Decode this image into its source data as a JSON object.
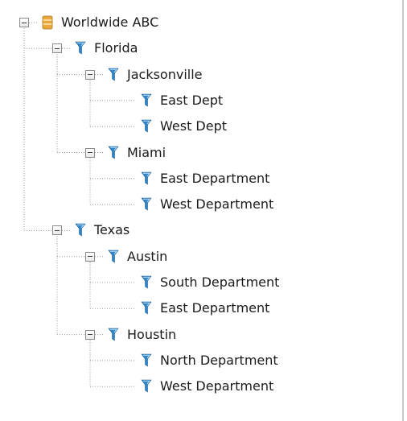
{
  "tree": {
    "nodes": [
      {
        "id": "root",
        "label": "Worldwide ABC",
        "icon": "database-icon",
        "level": 0,
        "expandable": true
      },
      {
        "id": "florida",
        "label": "Florida",
        "icon": "filter-icon",
        "level": 1,
        "expandable": true
      },
      {
        "id": "jacksonville",
        "label": "Jacksonville",
        "icon": "filter-icon",
        "level": 2,
        "expandable": true
      },
      {
        "id": "jax-east",
        "label": "East Dept",
        "icon": "filter-icon",
        "level": 3,
        "expandable": false
      },
      {
        "id": "jax-west",
        "label": "West Dept",
        "icon": "filter-icon",
        "level": 3,
        "expandable": false
      },
      {
        "id": "miami",
        "label": "Miami",
        "icon": "filter-icon",
        "level": 2,
        "expandable": true
      },
      {
        "id": "miami-east",
        "label": "East Department",
        "icon": "filter-icon",
        "level": 3,
        "expandable": false
      },
      {
        "id": "miami-west",
        "label": "West Department",
        "icon": "filter-icon",
        "level": 3,
        "expandable": false
      },
      {
        "id": "texas",
        "label": "Texas",
        "icon": "filter-icon",
        "level": 1,
        "expandable": true
      },
      {
        "id": "austin",
        "label": "Austin",
        "icon": "filter-icon",
        "level": 2,
        "expandable": true
      },
      {
        "id": "austin-south",
        "label": "South Department",
        "icon": "filter-icon",
        "level": 3,
        "expandable": false
      },
      {
        "id": "austin-east",
        "label": "East Department",
        "icon": "filter-icon",
        "level": 3,
        "expandable": false
      },
      {
        "id": "houstin",
        "label": "Houstin",
        "icon": "filter-icon",
        "level": 2,
        "expandable": true
      },
      {
        "id": "houstin-north",
        "label": "North Department",
        "icon": "filter-icon",
        "level": 3,
        "expandable": false
      },
      {
        "id": "houstin-west",
        "label": "West Department",
        "icon": "filter-icon",
        "level": 3,
        "expandable": false
      }
    ]
  },
  "colors": {
    "filter_icon": "#2f86c9",
    "database_icon": "#e8a93a",
    "connector": "#9a9a9a"
  }
}
